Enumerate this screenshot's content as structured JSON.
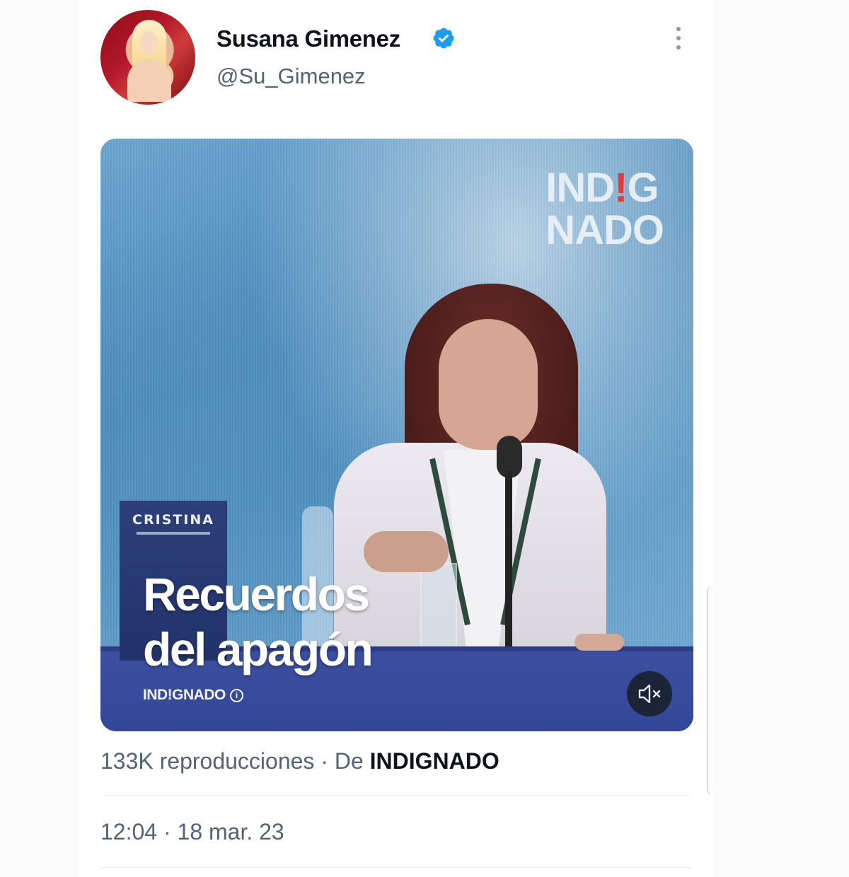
{
  "tweet": {
    "author_name": "Susana Gimenez",
    "author_handle": "@Su_Gimenez",
    "verified": true,
    "more_icon": "more-dots-icon",
    "media": {
      "brand_line1_a": "IND",
      "brand_line1_excl": "!",
      "brand_line1_b": "G",
      "brand_line2": "NADO",
      "book_title": "CRISTINA",
      "headline_line1": "Recuerdos",
      "headline_line2": "del apagón",
      "source_label": "IND!GNADO",
      "info_icon": "info-icon",
      "mute_icon": "speaker-muted-icon"
    },
    "views_text": "133K reproducciones",
    "separator": "·",
    "from_label": "De",
    "from_account": "INDIGNADO",
    "timestamp": "12:04 · 18 mar. 23"
  },
  "colors": {
    "text_primary": "#0f1419",
    "text_secondary": "#536471",
    "verified_blue": "#1d9bf0",
    "media_table_blue": "#33479a",
    "mute_button": "#1c2438"
  }
}
